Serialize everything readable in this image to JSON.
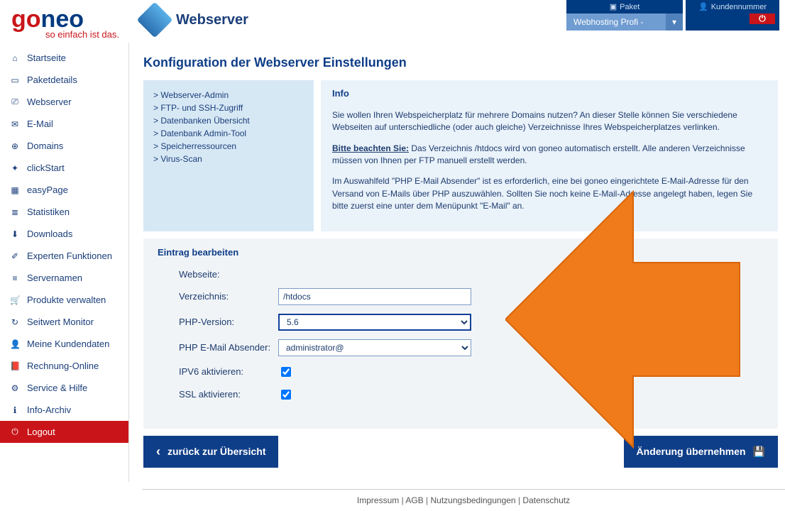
{
  "brand": {
    "go": "go",
    "neo": "neo",
    "tagline": "so einfach ist das."
  },
  "topbar": {
    "paket_label": "Paket",
    "paket_selected": "Webhosting Profi -",
    "kn_label": "Kundennummer"
  },
  "page_header": "Webserver",
  "sidebar": {
    "items": [
      {
        "icon": "⌂",
        "label": "Startseite"
      },
      {
        "icon": "▭",
        "label": "Paketdetails"
      },
      {
        "icon": "⎚",
        "label": "Webserver"
      },
      {
        "icon": "✉",
        "label": "E-Mail"
      },
      {
        "icon": "⊕",
        "label": "Domains"
      },
      {
        "icon": "✦",
        "label": "clickStart"
      },
      {
        "icon": "▦",
        "label": "easyPage"
      },
      {
        "icon": "≣",
        "label": "Statistiken"
      },
      {
        "icon": "⬇",
        "label": "Downloads"
      },
      {
        "icon": "✐",
        "label": "Experten Funktionen"
      },
      {
        "icon": "≡",
        "label": "Servernamen"
      },
      {
        "icon": "🛒",
        "label": "Produkte verwalten"
      },
      {
        "icon": "↻",
        "label": "Seitwert Monitor"
      },
      {
        "icon": "👤",
        "label": "Meine Kundendaten"
      },
      {
        "icon": "📕",
        "label": "Rechnung-Online"
      },
      {
        "icon": "⚙",
        "label": "Service & Hilfe"
      },
      {
        "icon": "ℹ",
        "label": "Info-Archiv"
      }
    ],
    "logout": {
      "icon": "⏻",
      "label": "Logout"
    }
  },
  "config_title": "Konfiguration der Webserver Einstellungen",
  "subnav": [
    "> Webserver-Admin",
    "> FTP- und SSH-Zugriff",
    "> Datenbanken Übersicht",
    "> Datenbank Admin-Tool",
    "> Speicherressourcen",
    "> Virus-Scan"
  ],
  "info": {
    "heading": "Info",
    "p1": "Sie wollen Ihren Webspeicherplatz für mehrere Domains nutzen? An dieser Stelle können Sie verschiedene Webseiten auf unterschiedliche (oder auch gleiche) Verzeichnisse Ihres Webspeicherplatzes verlinken.",
    "p2_bold": "Bitte beachten Sie:",
    "p2_rest": " Das Verzeichnis /htdocs wird von goneo automatisch erstellt. Alle anderen Verzeichnisse müssen von Ihnen per FTP manuell erstellt werden.",
    "p3": "Im Auswahlfeld \"PHP E-Mail Absender\" ist es erforderlich, eine bei goneo eingerichtete E-Mail-Adresse für den Versand von E-Mails über PHP auszuwählen. Sollten Sie noch keine E-Mail-Adresse angelegt haben, legen Sie bitte zuerst eine unter dem Menüpunkt \"E-Mail\" an."
  },
  "form": {
    "heading": "Eintrag bearbeiten",
    "webseite_label": "Webseite:",
    "webseite_value": "",
    "verzeichnis_label": "Verzeichnis:",
    "verzeichnis_value": "/htdocs",
    "phpver_label": "PHP-Version:",
    "phpver_value": "5.6",
    "phpmail_label": "PHP E-Mail Absender:",
    "phpmail_value": "administrator@",
    "ipv6_label": "IPV6 aktivieren:",
    "ssl_label": "SSL aktivieren:"
  },
  "buttons": {
    "back": "zurück zur Übersicht",
    "save": "Änderung übernehmen"
  },
  "footer": {
    "impressum": "Impressum",
    "agb": "AGB",
    "terms": "Nutzungsbedingungen",
    "privacy": "Datenschutz"
  }
}
